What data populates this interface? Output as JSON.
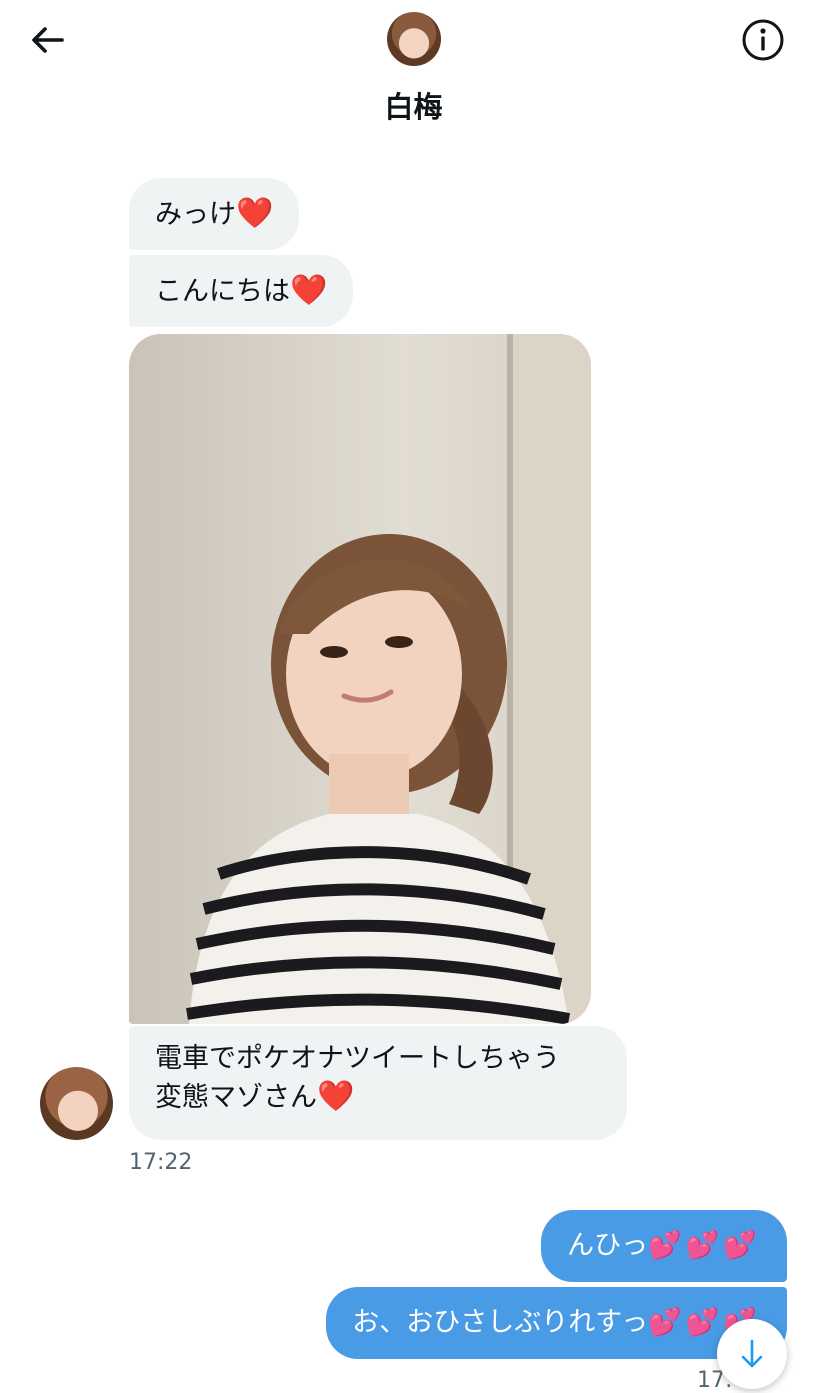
{
  "header": {
    "title": "白梅",
    "back_icon": "arrow-left-icon",
    "info_icon": "info-circle-icon"
  },
  "messages_in": [
    {
      "text": "みっけ",
      "emoji": "❤️"
    },
    {
      "text": "こんにちは",
      "emoji": "❤️"
    },
    {
      "line1": "電車でポケオナツイートしちゃう",
      "line2": "変態マゾさん",
      "emoji": "❤️"
    }
  ],
  "messages_in_time": "17:22",
  "messages_out": [
    {
      "text": "んひっ",
      "emoji": "💕💕💕"
    },
    {
      "text": "お、おひさしぶりれすっ",
      "emoji": "💕💕💕"
    }
  ],
  "messages_out_time": "17:",
  "colors": {
    "incoming_bubble": "#eff3f4",
    "outgoing_bubble": "#4a9be6",
    "timestamp": "#536471"
  },
  "scroll_icon": "arrow-down-icon"
}
